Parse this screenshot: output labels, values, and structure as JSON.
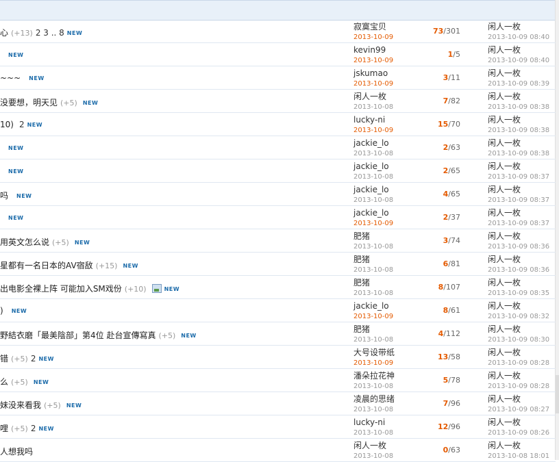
{
  "rows": [
    {
      "title": "心",
      "extra": "(+13)",
      "pages": "2 3 .. 8",
      "new": "NEW",
      "author": "寂寞宝贝",
      "date": "2013-10-09",
      "recent": true,
      "replies": "73",
      "views": "/301",
      "last_user": "闲人一枚",
      "last_time": "2013-10-09 08:40"
    },
    {
      "title": "",
      "extra": "",
      "pages": "",
      "new": "NEW",
      "author": "kevin99",
      "date": "2013-10-09",
      "recent": true,
      "replies": "1",
      "views": "/5",
      "last_user": "闲人一枚",
      "last_time": "2013-10-09 08:40"
    },
    {
      "title": "~~~",
      "extra": "",
      "pages": "",
      "new": "NEW",
      "author": "jskumao",
      "date": "2013-10-09",
      "recent": true,
      "replies": "3",
      "views": "/11",
      "last_user": "闲人一枚",
      "last_time": "2013-10-09 08:39"
    },
    {
      "title": "没要想，明天见",
      "extra": "(+5)",
      "pages": "",
      "new": "NEW",
      "author": "闲人一枚",
      "date": "2013-10-08",
      "recent": false,
      "replies": "7",
      "views": "/82",
      "last_user": "闲人一枚",
      "last_time": "2013-10-09 08:38"
    },
    {
      "title": "10)",
      "extra": "",
      "pages": "2",
      "new": "NEW",
      "author": "lucky-ni",
      "date": "2013-10-09",
      "recent": true,
      "replies": "15",
      "views": "/70",
      "last_user": "闲人一枚",
      "last_time": "2013-10-09 08:38"
    },
    {
      "title": "",
      "extra": "",
      "pages": "",
      "new": "NEW",
      "author": "jackie_lo",
      "date": "2013-10-08",
      "recent": false,
      "replies": "2",
      "views": "/63",
      "last_user": "闲人一枚",
      "last_time": "2013-10-09 08:38"
    },
    {
      "title": "",
      "extra": "",
      "pages": "",
      "new": "NEW",
      "author": "jackie_lo",
      "date": "2013-10-08",
      "recent": false,
      "replies": "2",
      "views": "/65",
      "last_user": "闲人一枚",
      "last_time": "2013-10-09 08:37"
    },
    {
      "title": "吗",
      "extra": "",
      "pages": "",
      "new": "NEW",
      "author": "jackie_lo",
      "date": "2013-10-08",
      "recent": false,
      "replies": "4",
      "views": "/65",
      "last_user": "闲人一枚",
      "last_time": "2013-10-09 08:37"
    },
    {
      "title": "",
      "extra": "",
      "pages": "",
      "new": "NEW",
      "author": "jackie_lo",
      "date": "2013-10-09",
      "recent": true,
      "replies": "2",
      "views": "/37",
      "last_user": "闲人一枚",
      "last_time": "2013-10-09 08:37"
    },
    {
      "title": "用英文怎么说",
      "extra": "(+5)",
      "pages": "",
      "new": "NEW",
      "author": "肥猪",
      "date": "2013-10-08",
      "recent": false,
      "replies": "3",
      "views": "/74",
      "last_user": "闲人一枚",
      "last_time": "2013-10-09 08:36"
    },
    {
      "title": "星都有一名日本的AV宿敌",
      "extra": "(+15)",
      "pages": "",
      "new": "NEW",
      "author": "肥猪",
      "date": "2013-10-08",
      "recent": false,
      "replies": "6",
      "views": "/81",
      "last_user": "闲人一枚",
      "last_time": "2013-10-09 08:36"
    },
    {
      "title": "出电影全裸上阵 可能加入SM戏份",
      "extra": "(+10)",
      "pages": "",
      "new": "NEW",
      "image": true,
      "author": "肥猪",
      "date": "2013-10-08",
      "recent": false,
      "replies": "8",
      "views": "/107",
      "last_user": "闲人一枚",
      "last_time": "2013-10-09 08:35"
    },
    {
      "title": ")",
      "extra": "",
      "pages": "",
      "new": "NEW",
      "author": "jackie_lo",
      "date": "2013-10-09",
      "recent": true,
      "replies": "8",
      "views": "/61",
      "last_user": "闲人一枚",
      "last_time": "2013-10-09 08:32"
    },
    {
      "title": "野結衣磨「最美陰部」第4位 赴台宣傳寫真",
      "extra": "(+5)",
      "pages": "",
      "new": "NEW",
      "author": "肥猪",
      "date": "2013-10-08",
      "recent": false,
      "replies": "4",
      "views": "/112",
      "last_user": "闲人一枚",
      "last_time": "2013-10-09 08:30"
    },
    {
      "title": "错",
      "extra": "(+5)",
      "pages": "2",
      "new": "NEW",
      "author": "大号设带纸",
      "date": "2013-10-09",
      "recent": true,
      "replies": "13",
      "views": "/58",
      "last_user": "闲人一枚",
      "last_time": "2013-10-09 08:28"
    },
    {
      "title": "么",
      "extra": "(+5)",
      "pages": "",
      "new": "NEW",
      "author": "潘朵拉花神",
      "date": "2013-10-08",
      "recent": false,
      "replies": "5",
      "views": "/78",
      "last_user": "闲人一枚",
      "last_time": "2013-10-09 08:28"
    },
    {
      "title": "妹没来看我",
      "extra": "(+5)",
      "pages": "",
      "new": "NEW",
      "author": "凌晨的思绪",
      "date": "2013-10-08",
      "recent": false,
      "replies": "7",
      "views": "/96",
      "last_user": "闲人一枚",
      "last_time": "2013-10-09 08:27"
    },
    {
      "title": "哩",
      "extra": "(+5)",
      "pages": "2",
      "new": "NEW",
      "author": "lucky-ni",
      "date": "2013-10-08",
      "recent": false,
      "replies": "12",
      "views": "/96",
      "last_user": "闲人一枚",
      "last_time": "2013-10-09 08:26"
    },
    {
      "title": "人想我吗",
      "extra": "",
      "pages": "",
      "new": "",
      "author": "闲人一枚",
      "date": "2013-10-08",
      "recent": false,
      "replies": "0",
      "views": "/63",
      "last_user": "闲人一枚",
      "last_time": "2013-10-08 18:01"
    }
  ]
}
